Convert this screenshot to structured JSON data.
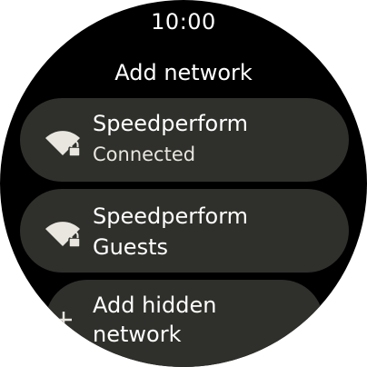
{
  "status_bar": {
    "time": "10:00"
  },
  "screen": {
    "title": "Add network"
  },
  "networks": [
    {
      "name": "Speedperform",
      "subtitle": "Connected",
      "icon": "wifi-lock-icon"
    },
    {
      "name": "Speedperform",
      "subtitle": "Guests",
      "icon": "wifi-lock-icon"
    }
  ],
  "add_hidden": {
    "line1": "Add hidden",
    "line2": "network",
    "icon": "plus-icon"
  },
  "colors": {
    "background": "#000000",
    "chip": "#2f302b",
    "text": "#ffffff",
    "icon": "#e8e6df"
  }
}
